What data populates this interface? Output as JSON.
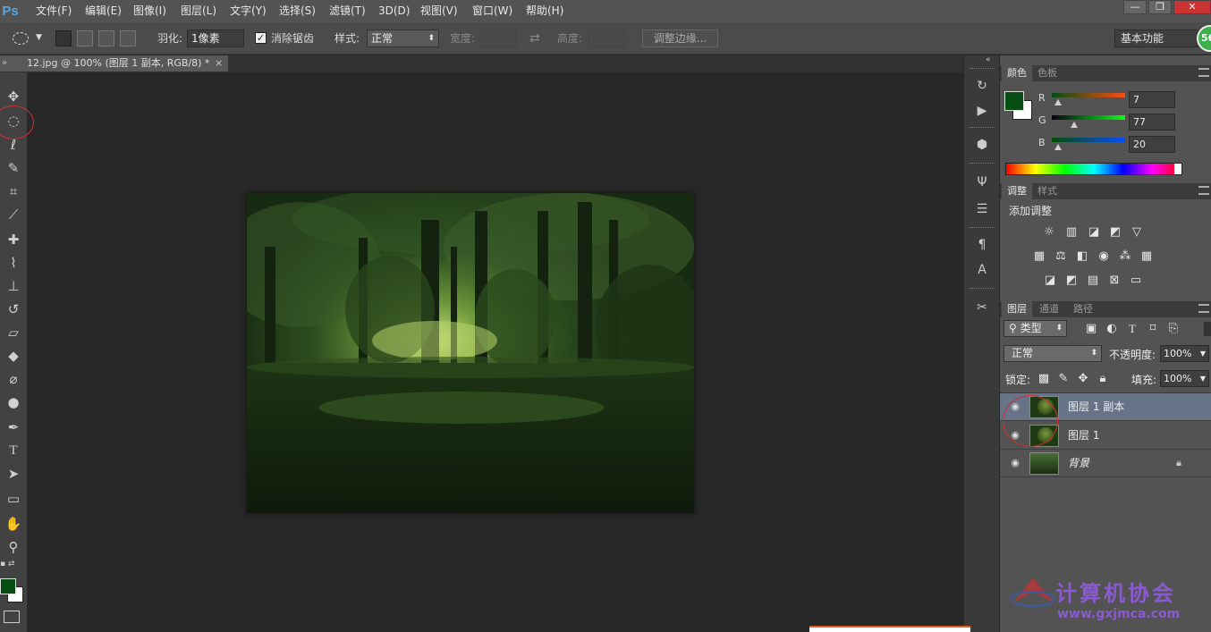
{
  "app": {
    "logo": "Ps"
  },
  "menu": [
    "文件(F)",
    "编辑(E)",
    "图像(I)",
    "图层(L)",
    "文字(Y)",
    "选择(S)",
    "滤镜(T)",
    "3D(D)",
    "视图(V)",
    "窗口(W)",
    "帮助(H)"
  ],
  "window_buttons": {
    "minimize": "—",
    "restore": "❐",
    "close": "✕"
  },
  "options": {
    "feather_label": "羽化:",
    "feather_value": "1像素",
    "antialias_label": "消除锯齿",
    "style_label": "样式:",
    "style_value": "正常",
    "width_label": "宽度:",
    "height_label": "高度:",
    "refine_edge": "调整边缘...",
    "workspace": "基本功能",
    "badge": "56"
  },
  "document": {
    "tab_title": "12.jpg @ 100% (图层 1 副本, RGB/8) *",
    "close": "×"
  },
  "color_panel": {
    "tabs": [
      "颜色",
      "色板"
    ],
    "r_label": "R",
    "r_value": "7",
    "g_label": "G",
    "g_value": "77",
    "b_label": "B",
    "b_value": "20",
    "r": 7,
    "g": 77,
    "b": 20,
    "foreground": "#074d14",
    "background": "#ffffff"
  },
  "adjustments_panel": {
    "tabs": [
      "调整",
      "样式"
    ],
    "title": "添加调整",
    "icons_row1": [
      "brightness-icon",
      "levels-icon",
      "curves-icon",
      "exposure-icon",
      "gradient-triangle-icon"
    ],
    "icons_row2": [
      "vibrance-icon",
      "balance-icon",
      "bw-icon",
      "photo-filter-icon",
      "channel-mixer-icon",
      "color-lookup-icon"
    ],
    "icons_row3": [
      "invert-icon",
      "posterize-icon",
      "threshold-icon",
      "selective-color-icon",
      "gradient-map-icon"
    ]
  },
  "layers_panel": {
    "tabs": [
      "图层",
      "通道",
      "路径"
    ],
    "filter_kind": "类型",
    "blend_mode": "正常",
    "opacity_label": "不透明度:",
    "opacity_value": "100%",
    "lock_label": "锁定:",
    "fill_label": "填充:",
    "fill_value": "100%",
    "layers": [
      {
        "name": "图层 1 副本",
        "selected": true
      },
      {
        "name": "图层 1",
        "selected": false
      },
      {
        "name": "背景",
        "selected": false,
        "locked": true
      }
    ]
  },
  "watermark": {
    "title": "计算机协会",
    "url": "www.gxjmca.com"
  },
  "colors": {
    "menubar": "#535353",
    "panel": "#535353",
    "canvas": "#282828",
    "selection": "#687388"
  }
}
